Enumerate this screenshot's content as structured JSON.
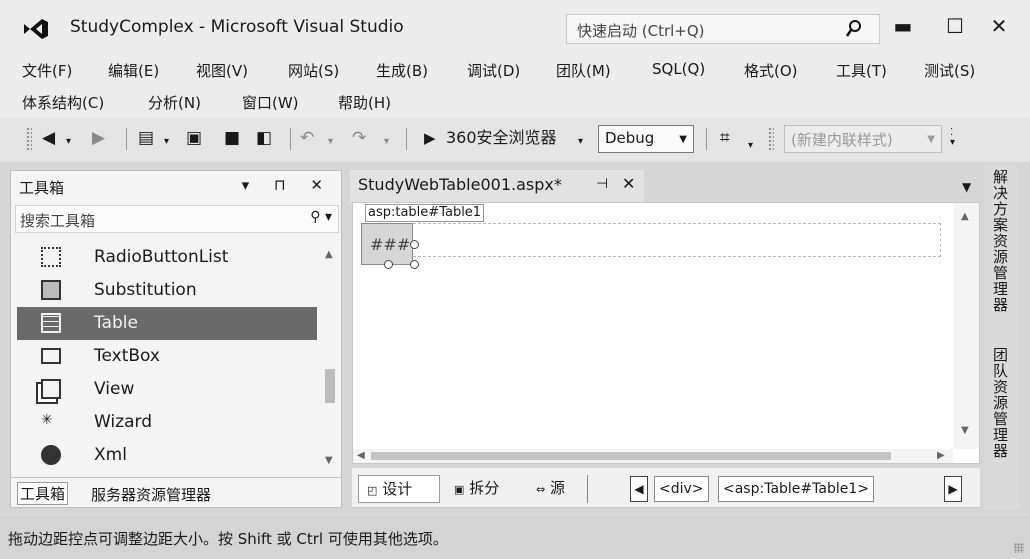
{
  "window": {
    "title": "StudyComplex - Microsoft Visual Studio",
    "quick_launch_placeholder": "快速启动 (Ctrl+Q)",
    "min_glyph": "▬",
    "max_glyph": "☐",
    "close_glyph": "✕"
  },
  "menu": {
    "row1": [
      "文件(F)",
      "编辑(E)",
      "视图(V)",
      "网站(S)",
      "生成(B)",
      "调试(D)",
      "团队(M)",
      "SQL(Q)",
      "格式(O)",
      "工具(T)",
      "测试(S)"
    ],
    "row2": [
      "体系结构(C)",
      "分析(N)",
      "窗口(W)",
      "帮助(H)"
    ]
  },
  "toolbar": {
    "run_browser": "360安全浏览器",
    "config": "Debug",
    "style_dropdown": "(新建内联样式)"
  },
  "toolbox": {
    "title": "工具箱",
    "header_buttons": "▾ 𝟒 ✕",
    "search_placeholder": "搜索工具箱",
    "items": [
      {
        "label": "RadioButtonList",
        "icon": "radiobuttonlist-icon"
      },
      {
        "label": "Substitution",
        "icon": "substitution-icon"
      },
      {
        "label": "Table",
        "icon": "table-icon"
      },
      {
        "label": "TextBox",
        "icon": "textbox-icon"
      },
      {
        "label": "View",
        "icon": "view-icon"
      },
      {
        "label": "Wizard",
        "icon": "wizard-icon"
      },
      {
        "label": "Xml",
        "icon": "xml-icon"
      }
    ],
    "selected": "Table",
    "tabs": [
      "工具箱",
      "服务器资源管理器"
    ]
  },
  "editor": {
    "tab_title": "StudyWebTable001.aspx*",
    "tag_label": "asp:table#Table1",
    "cell_text": "###"
  },
  "viewbar": {
    "design": "设计",
    "split": "拆分",
    "source": "源",
    "breadcrumbs": [
      "<div>",
      "<asp:Table#Table1>"
    ]
  },
  "right_panel": {
    "tabs": [
      "解决方案资源管理器",
      "团队资源管理器"
    ]
  },
  "status": {
    "text": "拖动边距控点可调整边距大小。按 Shift 或 Ctrl 可使用其他选项。"
  }
}
